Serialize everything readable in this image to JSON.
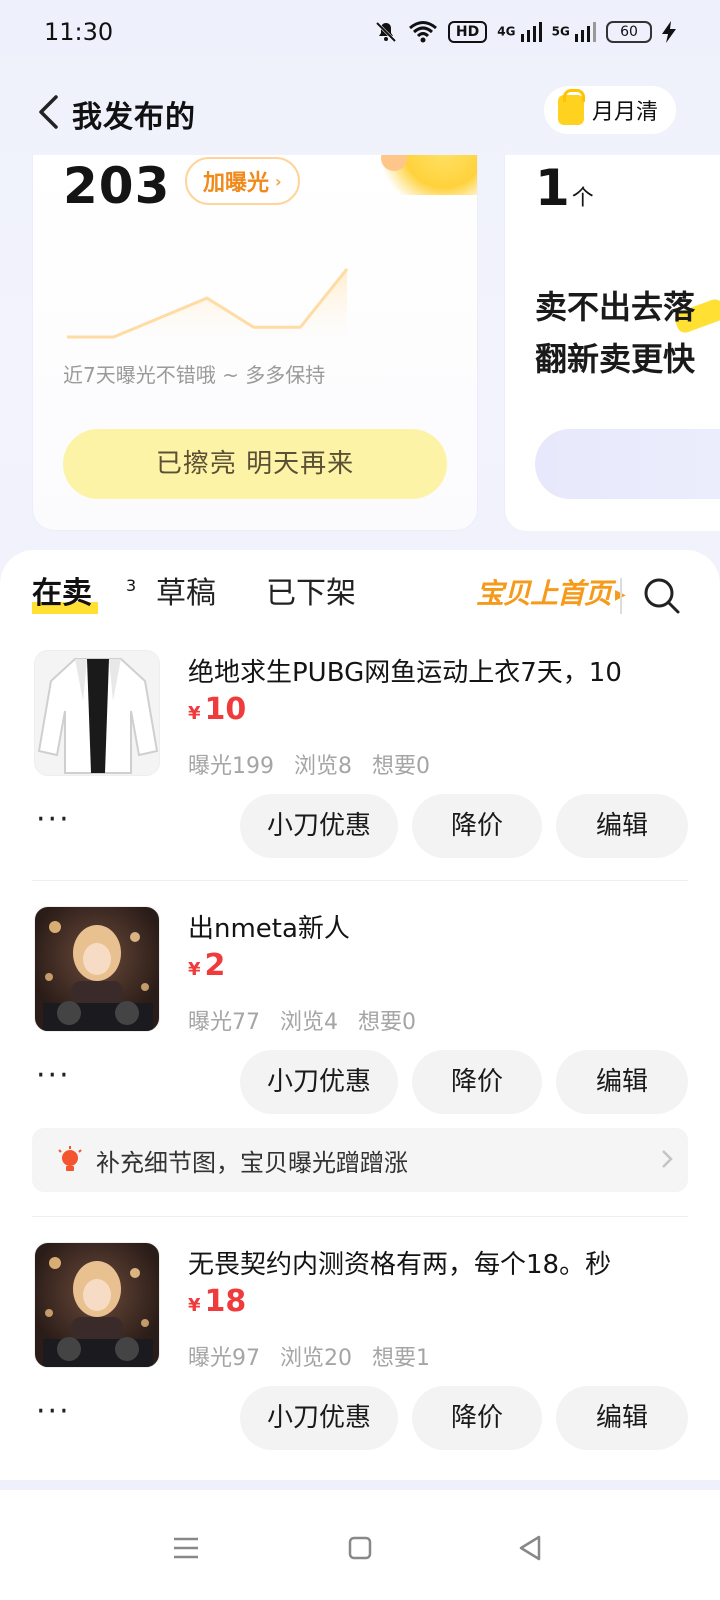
{
  "status_bar": {
    "time": "11:30",
    "hd_label": "HD",
    "net1": "4G",
    "net2": "5G",
    "battery": "60"
  },
  "header": {
    "title": "我发布的",
    "month_button": "月月清"
  },
  "exposure_card": {
    "count": "203",
    "boost_label": "加曝光",
    "hint": "近7天曝光不错哦 ~ 多多保持",
    "button_label": "已擦亮 明天再来",
    "trend_values": [
      1,
      1,
      3,
      5,
      2,
      2,
      8
    ]
  },
  "refresh_card": {
    "count": "1",
    "unit": "个",
    "line1": "卖不出去落",
    "line2": "翻新卖更快"
  },
  "tabs": {
    "on_sale": "在卖",
    "on_sale_count": "3",
    "drafts": "草稿",
    "removed": "已下架",
    "promo": "宝贝上首页"
  },
  "items": [
    {
      "title": "绝地求生PUBG网鱼运动上衣7天，10",
      "currency": "¥",
      "price": "10",
      "exposure": "曝光199",
      "views": "浏览8",
      "wants": "想要0",
      "more": "···",
      "action_discount": "小刀优惠",
      "action_reduce": "降价",
      "action_edit": "编辑"
    },
    {
      "title": "出nmeta新人",
      "currency": "¥",
      "price": "2",
      "exposure": "曝光77",
      "views": "浏览4",
      "wants": "想要0",
      "more": "···",
      "action_discount": "小刀优惠",
      "action_reduce": "降价",
      "action_edit": "编辑",
      "tip": "补充细节图，宝贝曝光蹭蹭涨"
    },
    {
      "title": "无畏契约内测资格有两，每个18。秒",
      "currency": "¥",
      "price": "18",
      "exposure": "曝光97",
      "views": "浏览20",
      "wants": "想要1",
      "more": "···",
      "action_discount": "小刀优惠",
      "action_reduce": "降价",
      "action_edit": "编辑"
    }
  ],
  "colors": {
    "price": "#ef3b3b",
    "accent_yellow": "#ffe033",
    "promo_orange": "#f59a1b"
  }
}
